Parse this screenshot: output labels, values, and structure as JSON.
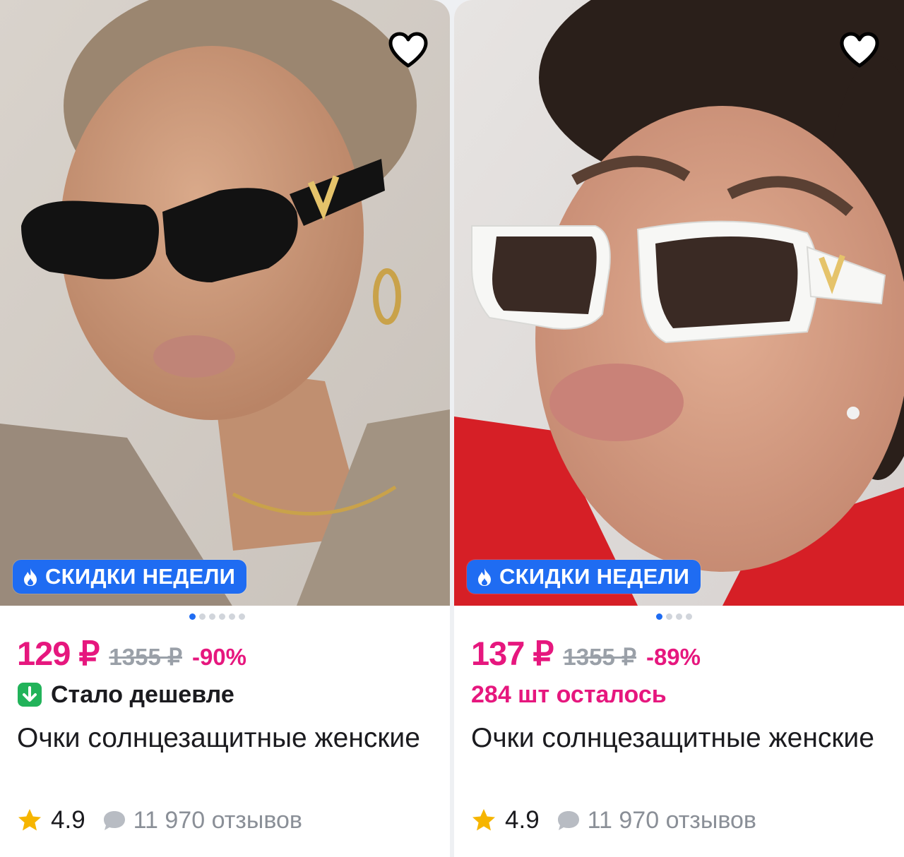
{
  "colors": {
    "price": "#e6177e",
    "promo_badge": "#1f6cf2",
    "price_drop_icon": "#22b35a",
    "star": "#f6b500",
    "muted": "#9aa0a8"
  },
  "products": [
    {
      "favorite_icon": "heart-outline-icon",
      "promo_badge": "СКИДКИ НЕДЕЛИ",
      "promo_icon": "flame-icon",
      "gallery_dots": {
        "total": 6,
        "active": 1
      },
      "price": "129 ₽",
      "old_price": "1355 ₽",
      "discount": "-90%",
      "status_icon": "arrow-down-icon",
      "status_text": "Стало дешевле",
      "title": "Очки солнцезащитные женские",
      "rating": "4.9",
      "reviews": "11 970 отзывов"
    },
    {
      "favorite_icon": "heart-outline-icon",
      "promo_badge": "СКИДКИ НЕДЕЛИ",
      "promo_icon": "flame-icon",
      "gallery_dots": {
        "total": 4,
        "active": 1
      },
      "price": "137 ₽",
      "old_price": "1355 ₽",
      "discount": "-89%",
      "stock_text": "284 шт осталось",
      "title": "Очки солнцезащитные женские",
      "rating": "4.9",
      "reviews": "11 970 отзывов"
    }
  ]
}
